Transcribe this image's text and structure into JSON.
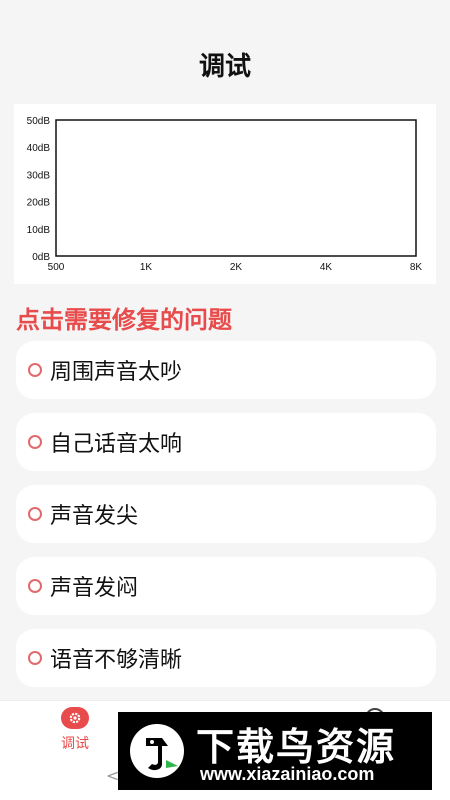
{
  "header": {
    "title": "调试"
  },
  "chart_data": {
    "type": "line",
    "title": "",
    "xlabel": "",
    "ylabel": "",
    "x_ticks": [
      "500",
      "1K",
      "2K",
      "4K",
      "8K"
    ],
    "y_ticks": [
      "0dB",
      "10dB",
      "20dB",
      "30dB",
      "40dB",
      "50dB"
    ],
    "ylim": [
      0,
      50
    ],
    "grid": false,
    "series": []
  },
  "section": {
    "heading": "点击需要修复的问题"
  },
  "issues": [
    {
      "label": "周围声音太吵"
    },
    {
      "label": "自己话音太响"
    },
    {
      "label": "声音发尖"
    },
    {
      "label": "声音发闷"
    },
    {
      "label": "语音不够清晰"
    }
  ],
  "tabbar": {
    "active_tab": {
      "label": "调试",
      "icon": "gear-icon",
      "color": "#e84b4b"
    }
  },
  "watermark": {
    "brand": "下载鸟资源",
    "url": "www.xiazainiao.com"
  },
  "colors": {
    "accent": "#e84b4b",
    "background": "#f5f5f5",
    "card": "#ffffff"
  }
}
